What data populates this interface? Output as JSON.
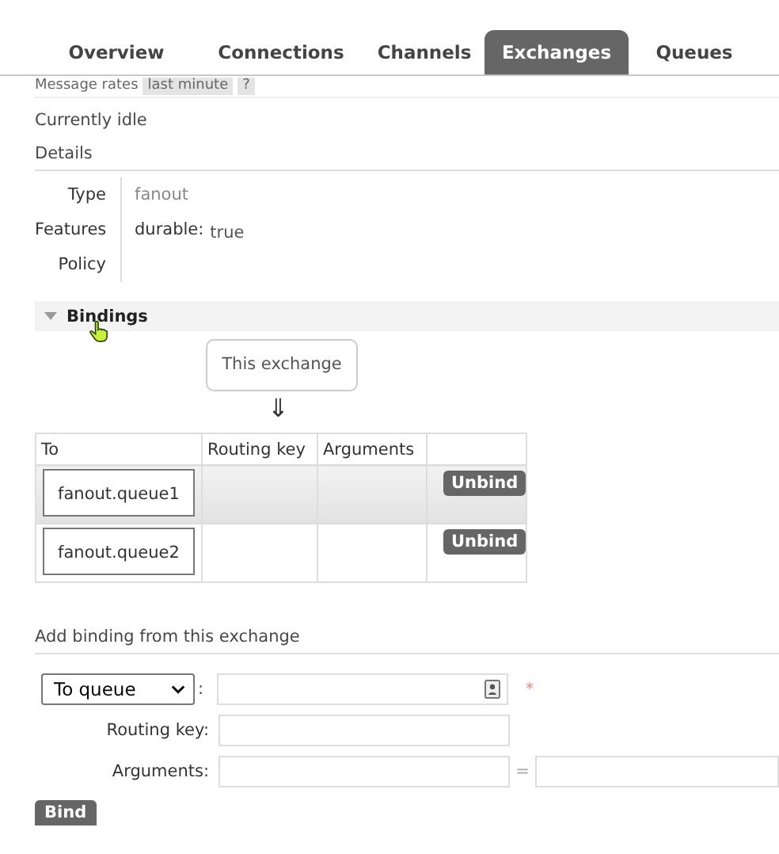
{
  "tabs": [
    {
      "label": "Overview",
      "selected": false
    },
    {
      "label": "Connections",
      "selected": false
    },
    {
      "label": "Channels",
      "selected": false
    },
    {
      "label": "Exchanges",
      "selected": true
    },
    {
      "label": "Queues",
      "selected": false
    }
  ],
  "message_rates": {
    "label": "Message rates",
    "value": "last minute",
    "help": "?"
  },
  "status": "Currently idle",
  "details": {
    "title": "Details",
    "rows": [
      {
        "label": "Type",
        "value": "fanout"
      },
      {
        "label": "Features",
        "key": "durable:",
        "value": "true"
      },
      {
        "label": "Policy"
      }
    ]
  },
  "bindings": {
    "title": "Bindings",
    "expanded": true,
    "source": "This exchange",
    "arrow": "⇓",
    "columns": [
      "To",
      "Routing key",
      "Arguments"
    ],
    "rows": [
      {
        "to": "fanout.queue1",
        "action": "Unbind",
        "highlighted": true
      },
      {
        "to": "fanout.queue2",
        "action": "Unbind",
        "highlighted": false
      }
    ]
  },
  "add_binding": {
    "title": "Add binding from this exchange",
    "destination_type": "To queue",
    "separator": ":",
    "required_mark": "*",
    "routing_key_label": "Routing key:",
    "arguments_label": "Arguments:",
    "equals": "=",
    "button": "Bind"
  }
}
